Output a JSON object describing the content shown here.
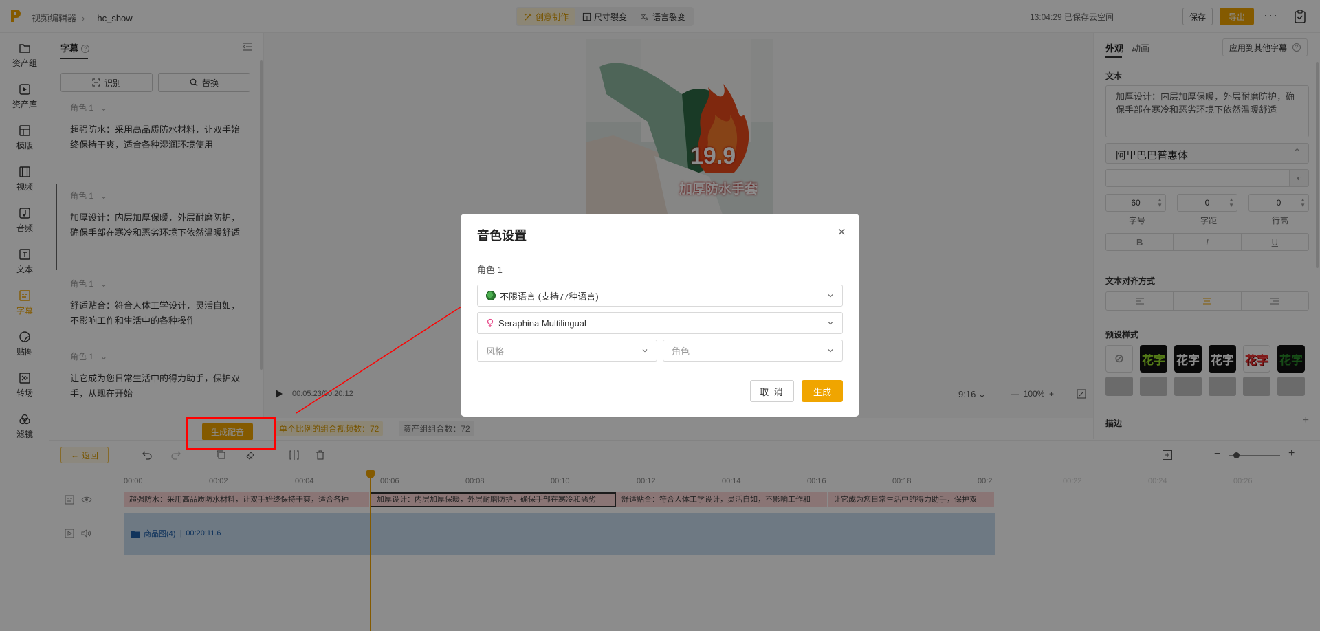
{
  "header": {
    "breadcrumb_root": "视频编辑器",
    "project_name": "hc_show",
    "modes": [
      "创意制作",
      "尺寸裂变",
      "语言裂变"
    ],
    "save_status": "13:04:29 已保存云空间",
    "save_label": "保存",
    "export_label": "导出"
  },
  "leftnav": [
    {
      "label": "资产组",
      "icon": "folder-icon"
    },
    {
      "label": "资产库",
      "icon": "asset-library-icon"
    },
    {
      "label": "模版",
      "icon": "template-icon"
    },
    {
      "label": "视频",
      "icon": "video-icon"
    },
    {
      "label": "音频",
      "icon": "audio-icon"
    },
    {
      "label": "文本",
      "icon": "text-icon"
    },
    {
      "label": "字幕",
      "icon": "subtitle-icon"
    },
    {
      "label": "贴图",
      "icon": "sticker-icon"
    },
    {
      "label": "转场",
      "icon": "transition-icon"
    },
    {
      "label": "滤镜",
      "icon": "filter-icon"
    }
  ],
  "subtitle_panel": {
    "tab_label": "字幕",
    "recognize_label": "识别",
    "replace_label": "替换",
    "items": [
      {
        "role": "角色 1",
        "text": "超强防水：采用高品质防水材料，让双手始终保持干爽，适合各种湿润环境使用"
      },
      {
        "role": "角色 1",
        "text": "加厚设计：内层加厚保暖，外层耐磨防护，确保手部在寒冷和恶劣环境下依然温暖舒适"
      },
      {
        "role": "角色 1",
        "text": "舒适贴合：符合人体工学设计，灵活自如，不影响工作和生活中的各种操作"
      },
      {
        "role": "角色 1",
        "text": "让它成为您日常生活中的得力助手，保护双手，从现在开始"
      }
    ]
  },
  "preview": {
    "price": "19.9",
    "product_caption": "加厚防水手套",
    "timecode": "00:05:23/00:20:12",
    "ratio": "9:16",
    "zoom": "100%"
  },
  "generate_row": {
    "generate_voice_label": "生成配音",
    "combo_label": "单个比例的组合视频数：72",
    "equals": "=",
    "asset_combo_label": "资产组组合数：72"
  },
  "right_panel": {
    "tab_appearance": "外观",
    "tab_animation": "动画",
    "apply_label": "应用到其他字幕",
    "text_label": "文本",
    "text_value": "加厚设计：内层加厚保暖，外层耐磨防护，确保手部在寒冷和恶劣环境下依然温暖舒适",
    "font_name": "阿里巴巴普惠体",
    "font_size": "60",
    "spacing": "0",
    "line_height": "0",
    "font_size_label": "字号",
    "spacing_label": "字距",
    "line_height_label": "行高",
    "bold": "B",
    "italic": "I",
    "underline": "U",
    "align_label": "文本对齐方式",
    "preset_label": "预设样式",
    "preset_text": "花字",
    "stroke_label": "描边"
  },
  "timeline": {
    "back_label": "返回",
    "ticks": [
      "00:00",
      "00:02",
      "00:04",
      "00:06",
      "00:08",
      "00:10",
      "00:12",
      "00:14",
      "00:16",
      "00:18",
      "00:2",
      "00:22",
      "00:24",
      "00:26"
    ],
    "subtitle_segments": [
      "超强防水：采用高品质防水材料，让双手始终保持干爽，适合各种",
      "加厚设计：内层加厚保暖，外层耐磨防护，确保手部在寒冷和恶劣",
      "舒适贴合：符合人体工学设计，灵活自如，不影响工作和",
      "让它成为您日常生活中的得力助手，保护双"
    ],
    "video_track_label": "商品图(4)",
    "video_track_duration": "00:20:11.6"
  },
  "modal": {
    "title": "音色设置",
    "role_label": "角色 1",
    "language_value": "不限语言 (支持77种语言)",
    "voice_value": "Seraphina Multilingual",
    "style_placeholder": "风格",
    "character_placeholder": "角色",
    "cancel_label": "取 消",
    "generate_label": "生成"
  }
}
